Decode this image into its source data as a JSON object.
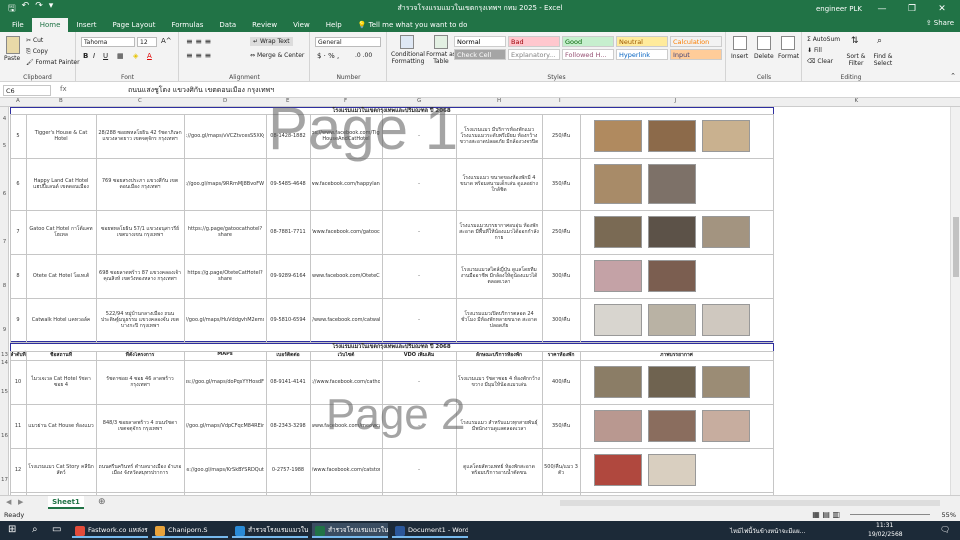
{
  "titlebar": {
    "title": "สำรวจโรงแรมแมวในเขตกรุงเทพฯ กทม 2025 - Excel",
    "user": "engineer PLK",
    "controls": {
      "minimize": "—",
      "restore": "❐",
      "close": "✕"
    }
  },
  "ribbon_tabs": [
    "File",
    "Home",
    "Insert",
    "Page Layout",
    "Formulas",
    "Data",
    "Review",
    "View",
    "Help"
  ],
  "tell_me": "Tell me what you want to do",
  "share": "Share",
  "ribbon": {
    "clipboard": {
      "paste": "Paste",
      "cut": "Cut",
      "copy": "Copy",
      "format_painter": "Format Painter",
      "label": "Clipboard"
    },
    "font": {
      "name": "Tahoma",
      "size": "12",
      "label": "Font"
    },
    "alignment": {
      "wrap_text": "Wrap Text",
      "merge": "Merge & Center",
      "label": "Alignment"
    },
    "number": {
      "format": "General",
      "label": "Number"
    },
    "styles": {
      "conditional": "Conditional Formatting",
      "format_table": "Format as Table",
      "cells": [
        {
          "text": "Normal",
          "bg": "#ffffff",
          "fg": "#000000"
        },
        {
          "text": "Bad",
          "bg": "#ffc7ce",
          "fg": "#9c0006"
        },
        {
          "text": "Good",
          "bg": "#c6efce",
          "fg": "#006100"
        },
        {
          "text": "Neutral",
          "bg": "#ffeb9c",
          "fg": "#9c5700"
        },
        {
          "text": "Calculation",
          "bg": "#f2f2f2",
          "fg": "#fa7d00"
        },
        {
          "text": "Check Cell",
          "bg": "#a5a5a5",
          "fg": "#ffffff"
        },
        {
          "text": "Explanatory...",
          "bg": "#ffffff",
          "fg": "#7f7f7f"
        },
        {
          "text": "Followed H...",
          "bg": "#ffffff",
          "fg": "#954f72"
        },
        {
          "text": "Hyperlink",
          "bg": "#ffffff",
          "fg": "#0563c1"
        },
        {
          "text": "Input",
          "bg": "#ffcc99",
          "fg": "#3f3f76"
        }
      ],
      "label": "Styles"
    },
    "cells": {
      "insert": "Insert",
      "delete": "Delete",
      "format": "Format",
      "label": "Cells"
    },
    "editing": {
      "autosum": "AutoSum",
      "fill": "Fill",
      "clear": "Clear",
      "sort": "Sort & Filter",
      "find": "Find & Select",
      "label": "Editing"
    }
  },
  "formula_bar": {
    "name_box": "C6",
    "fx": "fx",
    "value": "ถนนแสงชูโตง แขวงศิกัน เขตดอนเมือง กรุงเทพฯ"
  },
  "sheet": {
    "section_title": "โรงแรมแมวในเขตกรุงเทพและปริมณฑล ปี 2068",
    "headers": [
      "ลำดับที่",
      "ชื่อสถานที่",
      "ที่ตั้งโครงการ",
      "MAPs",
      "เบอร์ติดต่อ",
      "เว็บไซต์",
      "VDO เพิ่มเติม",
      "ลักษณะบริการห้องพัก",
      "ราคาห้องพัก",
      "ภาพบรรยากาศ"
    ],
    "watermarks": [
      "Page 1",
      "Page 2"
    ],
    "rows": [
      {
        "no": "5",
        "name": "Tigger's House & Cat Hotel",
        "addr": "28/288 ซอยพหลโยธิน 42 รัชดาภิเษก แขวงลาดยาว เขตจตุจักร กรุงเทพฯ",
        "map": "https://goo.gl/maps/vVCZtvcesS5XKy+G8",
        "tel": "08-1428-1882",
        "web": "https://www.facebook.com/Tigger HouseAndCatHotel",
        "vdo": "-",
        "desc": "โรงแรมแมว มีบริการห้องพักแมว โรงแรมแมวระดับพรีเมียม ห้องกว้างขวางสะอาดปลอดภัย มีกล้องวงจรปิด",
        "price": "250/คืน"
      },
      {
        "no": "6",
        "name": "Happy Land Cat Hotel แฮปปี้แลนด์ เขตดอนเมือง",
        "addr": "769 ซอยสรงประภา แขวงสีกัน เขตดอนเมือง กรุงเทพฯ",
        "map": "https://goo.gl/maps/9RRmMJ8BvoFWBAR6",
        "tel": "09-5485-4648",
        "web": "https://www.facebook.com/happylandcathotel",
        "vdo": "-",
        "desc": "โรงแรมแมว ขนาดของห้องพักมี 4 ขนาด พร้อมสนามเด็กเล่น ดูแลอย่างใกล้ชิด",
        "price": "350/คืน"
      },
      {
        "no": "7",
        "name": "Gatoo Cat Hotel กาโต้แคทโฮเทล",
        "addr": "ซอยพหลโยธิน 57/1 แขวงอนุสาวรีย์ เขตบางเขน กรุงเทพฯ",
        "map": "https://g.page/gatoocathotel?share",
        "tel": "08-7881-7711",
        "web": "https://www.facebook.com/gatoocathotel",
        "vdo": "-",
        "desc": "โรงแรมแมวบรรยากาศอบอุ่น ห้องพักสะอาด มีพื้นที่ให้น้องแมวได้ออกกำลังกาย",
        "price": "250/คืน"
      },
      {
        "no": "8",
        "name": "Otete Cat Hotel โอเทเต้",
        "addr": "698 ซอยลาดพร้าว 87 แขวงคลองเจ้าคุณสิงห์ เขตวังทองหลาง กรุงเทพฯ",
        "map": "https://g.page/OteteCatHotel?share",
        "tel": "09-9289-6164",
        "web": "https://www.facebook.com/OteteCatHotel",
        "vdo": "-",
        "desc": "โรงแรมแมวสไตล์ญี่ปุ่น ดูแลโดยทีมงานมืออาชีพ มีกล้องให้ดูน้องแมวได้ตลอดเวลา",
        "price": "300/คืน"
      },
      {
        "no": "9",
        "name": "Catwalk Hotel แคทวอล์ค",
        "addr": "522/94 หมู่บ้านกลางเมือง ถนนประดิษฐ์มนูธรรม แขวงคลองจั่น เขตบางกะปิ กรุงเทพฯ",
        "map": "https://goo.gl/maps/HuVddgvhM2ems2ND7",
        "tel": "09-5810-6594",
        "web": "https://www.facebook.com/catwalkhotel",
        "vdo": "-",
        "desc": "โรงแรมแมวเปิดบริการตลอด 24 ชั่วโมง มีห้องพักหลายขนาด สะอาด ปลอดภัย",
        "price": "300/คืน"
      },
      {
        "no": "10",
        "name": "ไมวเจเวล Cat Hotel รัชดาซอย 4",
        "addr": "รัชดาซอย 4 ซอย 46 ลาดพร้าว กรุงเทพฯ",
        "map": "https://goo.gl/maps/doPqsYYHosdFYc8",
        "tel": "08-9141-4141",
        "web": "https://www.facebook.com/cathotel18",
        "vdo": "-",
        "desc": "โรงแรมแมว รัชดาซอย 4 ห้องพักกว้างขวาง มีมุมให้น้องแมวเล่น",
        "price": "400/คืน"
      },
      {
        "no": "11",
        "name": "แมวย่าน Cat House ห้องแมว",
        "addr": "848/3 ซอยลาดพร้าว 4 ถนนรัชดา เขตจตุจักร กรุงเทพฯ",
        "map": "https://goo.gl/maps/VdpCFqcM84REinrWR5",
        "tel": "08-2343-3298",
        "web": "https://www.facebook.com/meowcathouse",
        "vdo": "-",
        "desc": "โรงแรมแมว สำหรับแมวทุกสายพันธุ์ มีพนักงานดูแลตลอดเวลา",
        "price": "350/คืน"
      },
      {
        "no": "12",
        "name": "โรงแรมแมว Cat Story คลีนิกสัตว์",
        "addr": "ถนนศรีนครินทร์ ตำบลบางเมือง อำเภอเมือง จังหวัดสมุทรปราการ",
        "map": "https://goo.gl/maps/KrSkBYSRDQutB67",
        "tel": "0-2757-1988",
        "web": "https://www.facebook.com/catstoryhotel",
        "vdo": "-",
        "desc": "ดูแลโดยสัตวแพทย์ ห้องพักสะอาด พร้อมบริการอาบน้ำตัดขน",
        "price": "500/คืน/แมว 3 ตัว"
      }
    ]
  },
  "sheet_tab": "Sheet1",
  "status": {
    "left": "Ready",
    "zoom": "55%"
  },
  "taskbar": {
    "items": [
      {
        "label": "Fastwork.co แหล่งรว...",
        "color": "#e34b3a"
      },
      {
        "label": "Chaniporn.S",
        "color": "#e8a33b"
      },
      {
        "label": "สำรวจโรงแรมแมวในเขต...",
        "color": "#2a8bd6"
      },
      {
        "label": "สำรวจโรงแรมแมวในเขต...",
        "color": "#217346"
      },
      {
        "label": "Document1 - Word",
        "color": "#2b579a"
      }
    ],
    "tray_text": "ไหม้ไฟนี้วันข้างหน้าจะมีแผ...",
    "time": "11:31",
    "date": "19/02/2568"
  }
}
